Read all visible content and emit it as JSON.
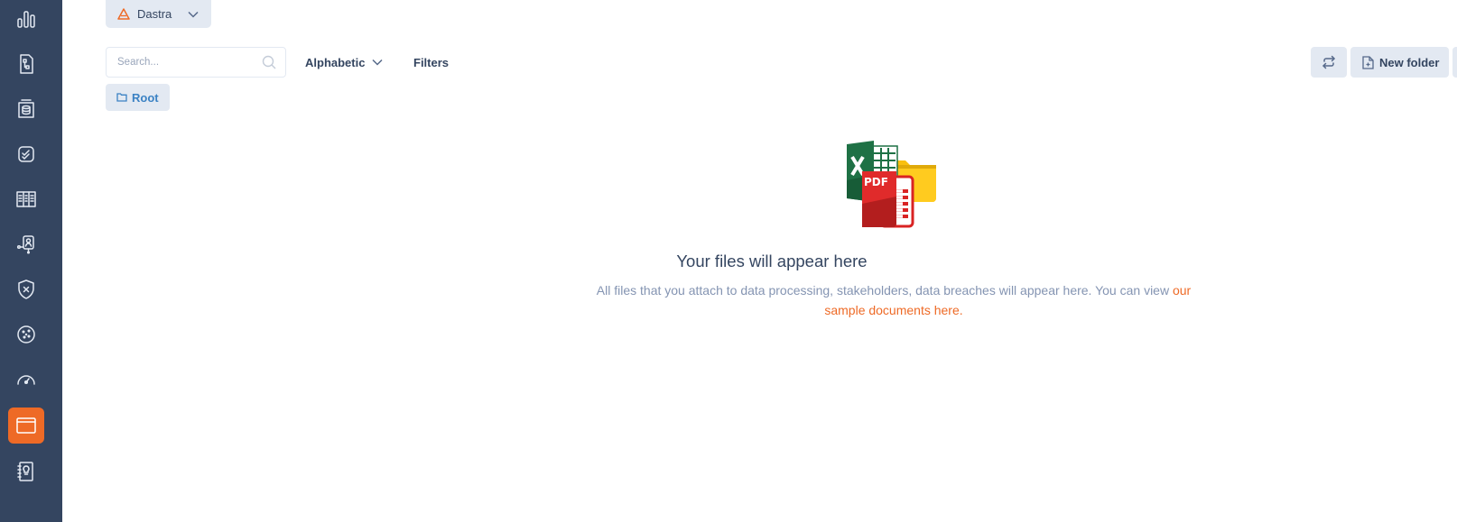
{
  "org": {
    "name": "Dastra"
  },
  "search": {
    "placeholder": "Search..."
  },
  "sort": {
    "label": "Alphabetic"
  },
  "filters": {
    "label": "Filters"
  },
  "actions": {
    "new_folder_label": "New folder"
  },
  "breadcrumb": {
    "root_label": "Root"
  },
  "empty_state": {
    "title": "Your files will appear here",
    "description": "All files that you attach to data processing, stakeholders, data breaches will appear here. You can view ",
    "link_label": "our sample documents here.",
    "pdf_badge": "PDF"
  },
  "sidebar": {
    "items": [
      {
        "icon": "bar-chart-icon"
      },
      {
        "icon": "process-document-icon"
      },
      {
        "icon": "database-register-icon"
      },
      {
        "icon": "checklist-icon"
      },
      {
        "icon": "table-grid-icon"
      },
      {
        "icon": "stakeholder-icon"
      },
      {
        "icon": "shield-x-icon"
      },
      {
        "icon": "cookie-icon"
      },
      {
        "icon": "gauge-icon"
      },
      {
        "icon": "folder-files-icon",
        "active": true
      },
      {
        "icon": "lightbulb-book-icon"
      }
    ]
  },
  "colors": {
    "sidebar_bg": "#344560",
    "accent": "#ee6a26",
    "button_bg": "#e3e9f2",
    "link_blue": "#3b82c4",
    "text_dark": "#344560",
    "text_muted": "#8494b2"
  }
}
